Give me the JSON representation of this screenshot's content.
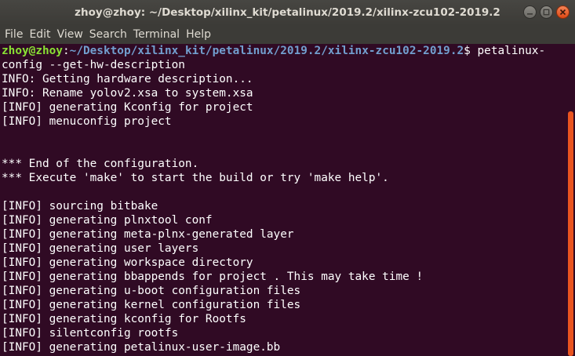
{
  "window": {
    "title": "zhoy@zhoy: ~/Desktop/xilinx_kit/petalinux/2019.2/xilinx-zcu102-2019.2",
    "controls": [
      "minimize-icon",
      "maximize-icon",
      "close-icon"
    ]
  },
  "menu": {
    "items": [
      "File",
      "Edit",
      "View",
      "Search",
      "Terminal",
      "Help"
    ]
  },
  "terminal": {
    "prompt": {
      "user": "zhoy@zhoy",
      "colon": ":",
      "path": "~/Desktop/xilinx_kit/petalinux/2019.2/xilinx-zcu102-2019.2",
      "symbol": "$ ",
      "command_start": "petalinux-"
    },
    "lines": [
      "config --get-hw-description",
      "INFO: Getting hardware description...",
      "INFO: Rename yolov2.xsa to system.xsa",
      "[INFO] generating Kconfig for project",
      "[INFO] menuconfig project",
      "",
      "",
      "*** End of the configuration.",
      "*** Execute 'make' to start the build or try 'make help'.",
      "",
      "[INFO] sourcing bitbake",
      "[INFO] generating plnxtool conf",
      "[INFO] generating meta-plnx-generated layer",
      "[INFO] generating user layers",
      "[INFO] generating workspace directory",
      "[INFO] generating bbappends for project . This may take time !",
      "[INFO] generating u-boot configuration files",
      "[INFO] generating kernel configuration files",
      "[INFO] generating kconfig for Rootfs",
      "[INFO] silentconfig rootfs",
      "[INFO] generating petalinux-user-image.bb"
    ]
  },
  "colors": {
    "background": "#300a24",
    "prompt_user": "#8ae234",
    "prompt_path": "#729fcf",
    "scrollbar_thumb": "#e95420",
    "titlebar": "#3c3b37"
  }
}
